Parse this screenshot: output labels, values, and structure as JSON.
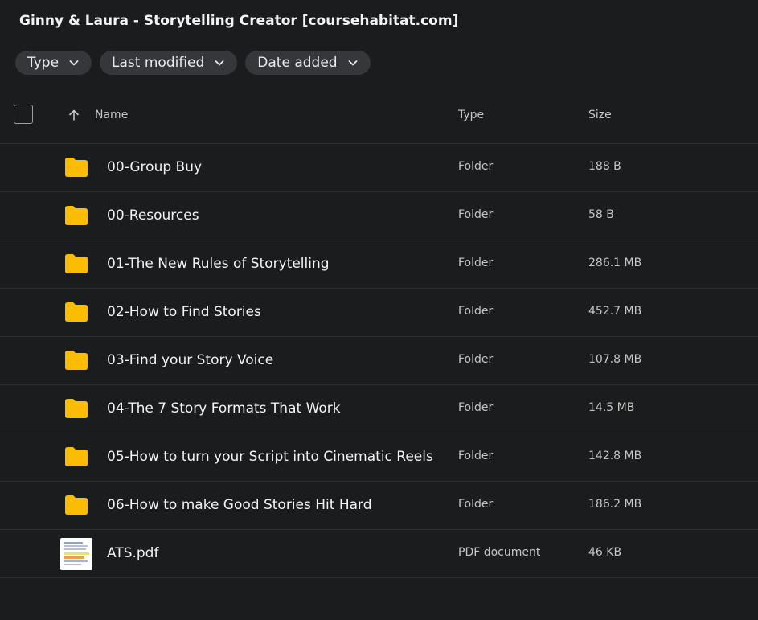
{
  "title": "Ginny & Laura - Storytelling Creator [coursehabitat.com]",
  "filters": [
    {
      "label": "Type",
      "icon": "chevron-down-icon"
    },
    {
      "label": "Last modified",
      "icon": "chevron-down-icon"
    },
    {
      "label": "Date added",
      "icon": "chevron-down-icon"
    }
  ],
  "columns": {
    "name": "Name",
    "type": "Type",
    "size": "Size",
    "sort_icon": "arrow-up-icon"
  },
  "items": [
    {
      "name": "00-Group Buy",
      "type": "Folder",
      "size": "188 B",
      "icon": "folder-icon"
    },
    {
      "name": "00-Resources",
      "type": "Folder",
      "size": "58 B",
      "icon": "folder-icon"
    },
    {
      "name": "01-The New Rules of Storytelling",
      "type": "Folder",
      "size": "286.1 MB",
      "icon": "folder-icon"
    },
    {
      "name": "02-How to Find Stories",
      "type": "Folder",
      "size": "452.7 MB",
      "icon": "folder-icon"
    },
    {
      "name": "03-Find your Story Voice",
      "type": "Folder",
      "size": "107.8 MB",
      "icon": "folder-icon"
    },
    {
      "name": "04-The 7 Story Formats That Work",
      "type": "Folder",
      "size": "14.5 MB",
      "icon": "folder-icon"
    },
    {
      "name": "05-How to turn your Script into Cinematic Reels",
      "type": "Folder",
      "size": "142.8 MB",
      "icon": "folder-icon"
    },
    {
      "name": "06-How to make Good Stories Hit Hard",
      "type": "Folder",
      "size": "186.2 MB",
      "icon": "folder-icon"
    },
    {
      "name": "ATS.pdf",
      "type": "PDF document",
      "size": "46 KB",
      "icon": "pdf-thumbnail-icon"
    }
  ],
  "colors": {
    "background": "#1b1c1d",
    "chip": "#35373a",
    "folder": "#fbbc04",
    "divider": "#2f3133"
  }
}
